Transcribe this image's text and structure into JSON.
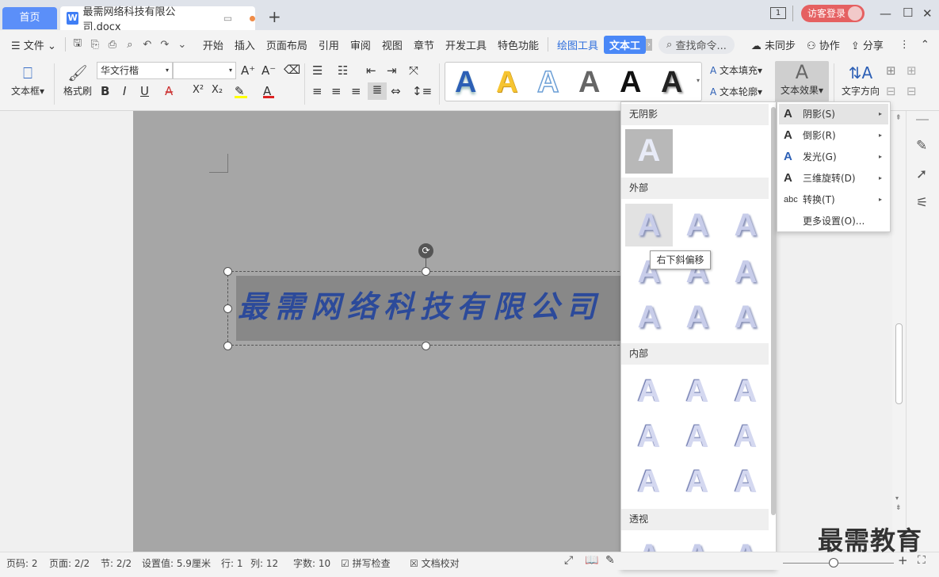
{
  "titlebar": {
    "home_tab": "首页",
    "doc_tab": "最需网络科技有限公司.docx",
    "doc_icon": "W",
    "new_tab": "+",
    "login": "访客登录",
    "page_indicator": "1"
  },
  "menu": {
    "file": "文件",
    "items": [
      "开始",
      "插入",
      "页面布局",
      "引用",
      "审阅",
      "视图",
      "章节",
      "开发工具",
      "特色功能"
    ],
    "draw_tools": "绘图工具",
    "text_tools": "文本工",
    "search": "查找命令...",
    "unsync": "未同步",
    "collab": "协作",
    "share": "分享"
  },
  "ribbon": {
    "textbox": "文本框",
    "format_painter": "格式刷",
    "font_name": "华文行楷",
    "font_size": "",
    "bold": "B",
    "italic": "I",
    "underline": "U",
    "superscript": "X²",
    "subscript": "X₂",
    "gallery_letter": "A",
    "text_fill": "文本填充",
    "text_outline": "文本轮廓",
    "text_effects": "文本效果",
    "text_direction": "文字方向"
  },
  "document": {
    "wordart_text": "最需网络科技有限公司"
  },
  "effects_panel": {
    "sections": [
      "无阴影",
      "外部",
      "内部",
      "透视"
    ],
    "sample_letter": "A",
    "tooltip": "右下斜偏移"
  },
  "submenu": {
    "items": [
      {
        "icon": "A",
        "label": "阴影(S)"
      },
      {
        "icon": "A",
        "label": "倒影(R)"
      },
      {
        "icon": "A",
        "label": "发光(G)"
      },
      {
        "icon": "A",
        "label": "三维旋转(D)"
      },
      {
        "icon": "abc",
        "label": "转换(T)"
      },
      {
        "icon": "",
        "label": "更多设置(O)..."
      }
    ]
  },
  "statusbar": {
    "page_num": "页码: 2",
    "pages": "页面: 2/2",
    "section": "节: 2/2",
    "setting": "设置值: 5.9厘米",
    "row": "行: 1",
    "col": "列: 12",
    "wordcount": "字数: 10",
    "spellcheck": "拼写检查",
    "proofread": "文档校对"
  },
  "watermark": "最需教育"
}
